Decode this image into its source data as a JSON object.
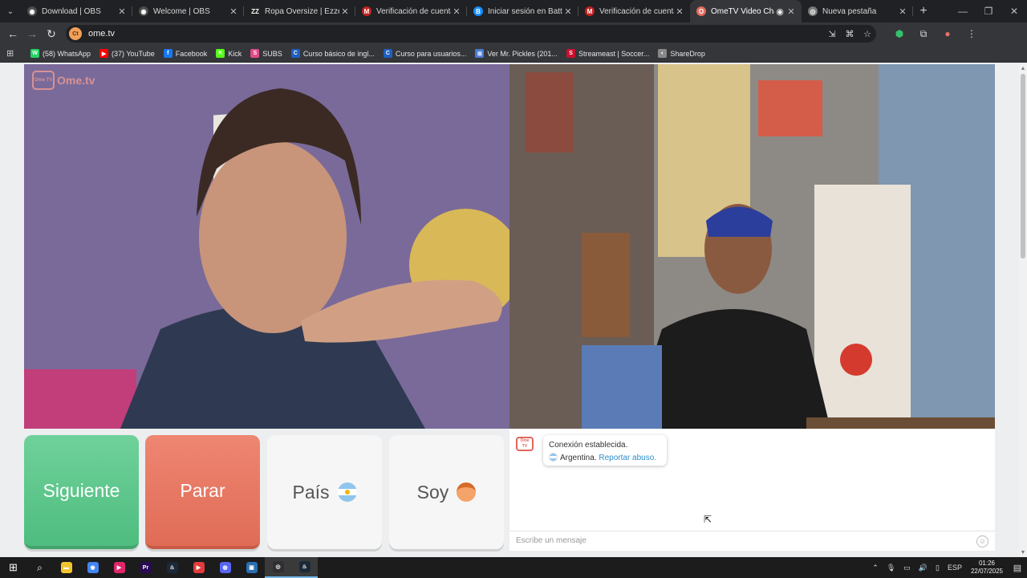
{
  "tabs": [
    {
      "title": "Download | OBS",
      "color": "#4d4d4d",
      "glyph": "◉"
    },
    {
      "title": "Welcome | OBS",
      "color": "#4d4d4d",
      "glyph": "◉"
    },
    {
      "title": "Ropa Oversize | Ezzeta Co",
      "color": "#222",
      "glyph": "ZZ"
    },
    {
      "title": "Verificación de cuenta de",
      "color": "#c5221f",
      "glyph": "M"
    },
    {
      "title": "Iniciar sesión en Battle.net",
      "color": "#148eff",
      "glyph": "B"
    },
    {
      "title": "Verificación de cuenta de",
      "color": "#c5221f",
      "glyph": "M"
    },
    {
      "title": "OmeTV Video Chat -",
      "color": "#e36b5b",
      "glyph": "O"
    },
    {
      "title": "Nueva pestaña",
      "color": "#777",
      "glyph": "◎"
    }
  ],
  "address": {
    "url": "ome.tv"
  },
  "bookmarks": [
    {
      "label": "(58) WhatsApp",
      "color": "#25d366",
      "glyph": "W"
    },
    {
      "label": "(37) YouTube",
      "color": "#ff0000",
      "glyph": "▶"
    },
    {
      "label": "Facebook",
      "color": "#1877f2",
      "glyph": "f"
    },
    {
      "label": "Kick",
      "color": "#53fc18",
      "glyph": "K"
    },
    {
      "label": "SUBS",
      "color": "#e04a8a",
      "glyph": "S"
    },
    {
      "label": "Curso básico de ingl...",
      "color": "#1f5fbf",
      "glyph": "C"
    },
    {
      "label": "Curso para usuarios...",
      "color": "#1f5fbf",
      "glyph": "C"
    },
    {
      "label": "Ver Mr. Pickles (201...",
      "color": "#4a7bd0",
      "glyph": "⊞"
    },
    {
      "label": "Streameast | Soccer...",
      "color": "#c8102e",
      "glyph": "S"
    },
    {
      "label": "ShareDrop",
      "color": "#888",
      "glyph": "◐"
    }
  ],
  "ome": {
    "logo_text": "Ome.tv",
    "logo_box": "Ome TV"
  },
  "buttons": {
    "next": "Siguiente",
    "stop": "Parar",
    "country": "País",
    "gender": "Soy"
  },
  "chat": {
    "status": "Conexión establecida.",
    "country": "Argentina.",
    "report": "Reportar abuso.",
    "placeholder": "Escribe un mensaje"
  },
  "taskbar": {
    "apps": [
      {
        "name": "file-explorer",
        "color": "#f4c430",
        "glyph": "▬"
      },
      {
        "name": "chrome",
        "color": "#4285f4",
        "glyph": "◉"
      },
      {
        "name": "media-player",
        "color": "#e3256b",
        "glyph": "▶"
      },
      {
        "name": "premiere",
        "color": "#2a0a55",
        "glyph": "Pr"
      },
      {
        "name": "steam",
        "color": "#1b2838",
        "glyph": "♨"
      },
      {
        "name": "video-app",
        "color": "#e23b3b",
        "glyph": "▶"
      },
      {
        "name": "discord",
        "color": "#5865f2",
        "glyph": "◍"
      },
      {
        "name": "remote-app",
        "color": "#2a6fb0",
        "glyph": "▣"
      },
      {
        "name": "obs",
        "color": "#302e31",
        "glyph": "◎"
      },
      {
        "name": "steam-2",
        "color": "#1b2838",
        "glyph": "♨"
      }
    ],
    "lang": "ESP",
    "time": "01:26",
    "date": "22/07/2025"
  }
}
